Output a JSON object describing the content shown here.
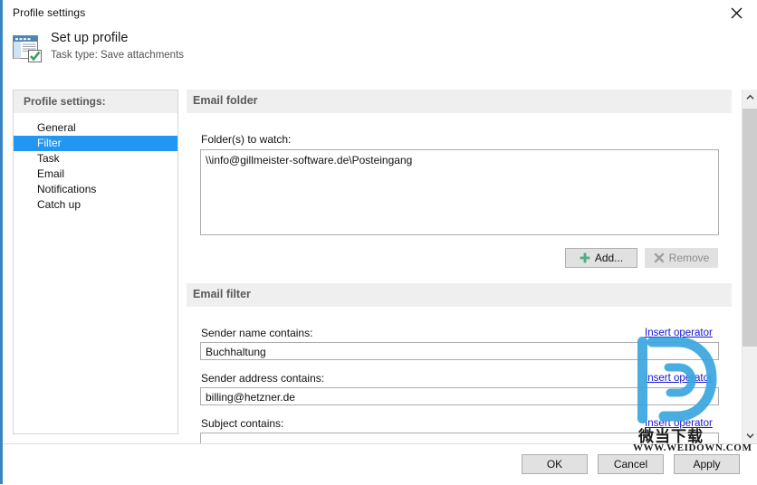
{
  "window": {
    "title": "Profile settings",
    "close_icon": "close-icon",
    "accent_color": "#3b84c4"
  },
  "header": {
    "icon": "form-with-checkmark-icon",
    "title": "Set up profile",
    "subtitle": "Task type: Save attachments"
  },
  "sidebar": {
    "heading": "Profile settings:",
    "items": [
      {
        "label": "General",
        "selected": false
      },
      {
        "label": "Filter",
        "selected": true
      },
      {
        "label": "Task",
        "selected": false
      },
      {
        "label": "Email",
        "selected": false
      },
      {
        "label": "Notifications",
        "selected": false
      },
      {
        "label": "Catch up",
        "selected": false
      }
    ],
    "selection_color": "#2196f3"
  },
  "main": {
    "email_folder": {
      "section_title": "Email folder",
      "folders_label": "Folder(s) to watch:",
      "folders_value": "\\\\info@gillmeister-software.de\\Posteingang",
      "add_button": {
        "label": "Add...",
        "icon": "plus-icon",
        "icon_color": "#4caf82",
        "enabled": true
      },
      "remove_button": {
        "label": "Remove",
        "icon": "cross-icon",
        "icon_color": "#9e9e9e",
        "enabled": false
      }
    },
    "email_filter": {
      "section_title": "Email filter",
      "fields": [
        {
          "label": "Sender name contains:",
          "value": "Buchhaltung",
          "link": "Insert operator"
        },
        {
          "label": "Sender address contains:",
          "value": "billing@hetzner.de",
          "link": "Insert operator"
        },
        {
          "label": "Subject contains:",
          "value": "",
          "link": "Insert operator"
        }
      ]
    }
  },
  "scrollbar": {
    "up_arrow": "chevron-up-icon",
    "down_arrow": "chevron-down-icon"
  },
  "footer": {
    "ok": "OK",
    "cancel": "Cancel",
    "apply": "Apply"
  },
  "watermark": {
    "logo": "weidown-d-logo",
    "cn_text": "微当下载",
    "url_text": "WWW.WEIDOWN.COM",
    "color": "#3aa7e0"
  }
}
